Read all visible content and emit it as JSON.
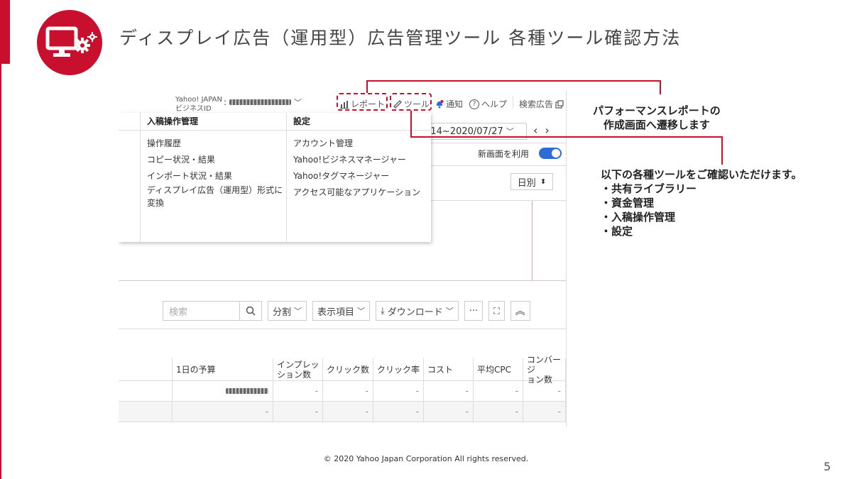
{
  "slide": {
    "title": "ディスプレイ広告（運用型）広告管理ツール 各種ツール確認方法",
    "icon": "monitor-gear-icon",
    "accent": "#c8102e",
    "footer": "© 2020 Yahoo Japan Corporation All rights reserved.",
    "page_number": "5"
  },
  "topbar": {
    "biz_label_line1": "Yahoo! JAPAN",
    "biz_label_line2": "ビジネスID",
    "colon": ":",
    "report": "レポート",
    "tool": "ツール",
    "notify": "通知",
    "help": "ヘルプ",
    "search_ads": "検索広告"
  },
  "date_range": "/14~2020/07/27",
  "toggle_label": "新画面を利用",
  "daily_select": "日別",
  "dropdown": {
    "col1": {
      "header": "入稿操作管理",
      "items": [
        "操作履歴",
        "コピー状況・結果",
        "インポート状況・結果",
        "ディスプレイ広告（運用型）形式に",
        "変換"
      ]
    },
    "col2": {
      "header": "設定",
      "items": [
        "アカウント管理",
        "Yahoo!ビジネスマネージャー",
        "Yahoo!タグマネージャー",
        "アクセス可能なアプリケーション"
      ]
    }
  },
  "toolbar": {
    "search_placeholder": "検索",
    "split": "分割",
    "display_items": "表示項目",
    "download": "ダウンロード",
    "more": "···"
  },
  "table": {
    "headers": [
      "",
      "1日の予算",
      "インプレッション数",
      "クリック数",
      "クリック率",
      "コスト",
      "平均CPC",
      "コンバージョン数"
    ],
    "header_lines": [
      [
        "",
        ""
      ],
      [
        "1日の予算",
        ""
      ],
      [
        "インプレッ",
        "ション数"
      ],
      [
        "クリック数",
        ""
      ],
      [
        "クリック率",
        ""
      ],
      [
        "コスト",
        ""
      ],
      [
        "平均CPC",
        ""
      ],
      [
        "コンバージ",
        "ョン数"
      ]
    ],
    "rows": [
      [
        "",
        "",
        "-",
        "-",
        "-",
        "-",
        "-",
        "-"
      ],
      [
        "",
        "-",
        "-",
        "-",
        "-",
        "-",
        "-",
        "-"
      ]
    ]
  },
  "callouts": {
    "note1_line1": "パフォーマンスレポートの",
    "note1_line2": "作成画面へ遷移します",
    "note2_line1": "以下の各種ツールをご確認いただけます。",
    "note2_items": [
      "・共有ライブラリー",
      "・資金管理",
      "・入稿操作管理",
      "・設定"
    ]
  }
}
